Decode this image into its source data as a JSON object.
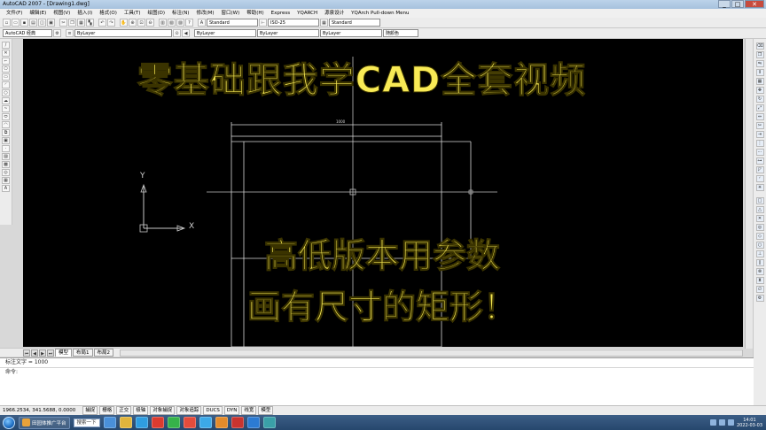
{
  "window": {
    "title": "AutoCAD 2007 - [Drawing1.dwg]",
    "minimize": "_",
    "maximize": "□",
    "close": "✕"
  },
  "menu": {
    "items": [
      "文件(F)",
      "编辑(E)",
      "视图(V)",
      "插入(I)",
      "格式(O)",
      "工具(T)",
      "绘图(D)",
      "标注(N)",
      "修改(M)",
      "窗口(W)",
      "帮助(H)",
      "Express",
      "YQARCH",
      "源泉设计",
      "YQArch Pull-down Menu"
    ]
  },
  "toolbar": {
    "text_style": "Standard",
    "dim_style": "ISO-25",
    "table_style": "Standard",
    "workspace": "AutoCAD 经典",
    "layer": "ByLayer",
    "linetype": "ByLayer",
    "color_label": "随颜色"
  },
  "canvas": {
    "title_text": "零基础跟我学CAD全套视频",
    "subtitle_line1": "高低版本用参数",
    "subtitle_line2": "画有尺寸的矩形！",
    "ucs_x": "X",
    "ucs_y": "Y",
    "dim_text": "1000"
  },
  "layout_tabs": {
    "model": "模型",
    "layout1": "布局1",
    "layout2": "布局2"
  },
  "command": {
    "history": "标注文字 = 1000",
    "prompt": "命令:"
  },
  "status": {
    "coords": "1966.2534, 341.5688, 0.0000",
    "buttons": [
      "捕捉",
      "栅格",
      "正交",
      "极轴",
      "对象捕捉",
      "对象追踪",
      "DUCS",
      "DYN",
      "线宽",
      "模型"
    ]
  },
  "taskbar": {
    "app_button": "田园体推广平台",
    "search": "搜索一下",
    "time": "14:01",
    "date": "2022-03-03"
  },
  "colors": {
    "canvas_bg": "#000000",
    "overlay_text": "#f8ea55",
    "drawing_lines": "#d8d8d8"
  }
}
